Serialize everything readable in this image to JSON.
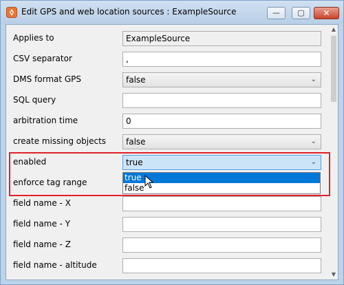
{
  "window": {
    "title": "Edit GPS and web location sources : ExampleSource",
    "controls": {
      "minimize": "—",
      "maximize": "▢",
      "close": "✕"
    }
  },
  "form": {
    "rows": [
      {
        "label": "Applies to",
        "value": "ExampleSource",
        "kind": "readonly"
      },
      {
        "label": "CSV separator",
        "value": ",",
        "kind": "text"
      },
      {
        "label": "DMS format GPS",
        "value": "false",
        "kind": "combo"
      },
      {
        "label": "SQL query",
        "value": "",
        "kind": "text"
      },
      {
        "label": "arbitration time",
        "value": "0",
        "kind": "text"
      },
      {
        "label": "create missing objects",
        "value": "false",
        "kind": "combo"
      },
      {
        "label": "enabled",
        "value": "true",
        "kind": "combo",
        "focused": true
      },
      {
        "label": "enforce tag range",
        "value": "",
        "kind": "hidden"
      },
      {
        "label": "field name - X",
        "value": "",
        "kind": "text"
      },
      {
        "label": "field name - Y",
        "value": "",
        "kind": "text"
      },
      {
        "label": "field name - Z",
        "value": "",
        "kind": "text"
      },
      {
        "label": "field name - altitude",
        "value": "",
        "kind": "text"
      }
    ]
  },
  "dropdown": {
    "options": [
      "true",
      "false"
    ],
    "selected": "true"
  },
  "colors": {
    "highlight_border": "#e0202a",
    "selection": "#0078d7"
  }
}
